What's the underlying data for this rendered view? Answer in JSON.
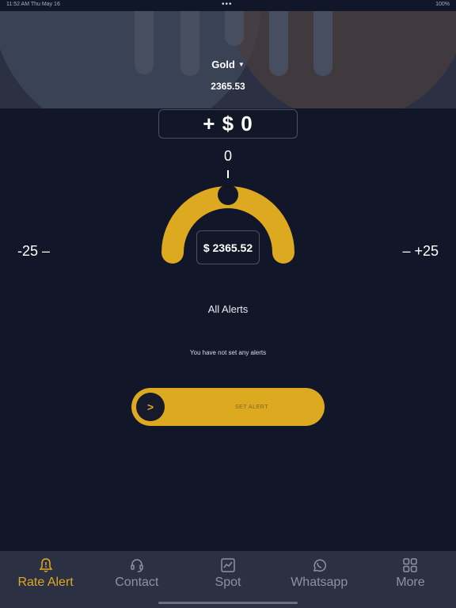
{
  "status_bar": {
    "left": "11:52 AM  Thu May 16",
    "center": "•••",
    "right": "100%"
  },
  "header": {
    "metal": "Gold",
    "price": "2365.53"
  },
  "calculator": {
    "delta_display": "+ $ 0",
    "offset_value": "0",
    "current_rate": "$ 2365.52",
    "minus_step": "-25 –",
    "plus_step": "– +25"
  },
  "alerts": {
    "title": "All Alerts",
    "empty_message": "You have not set any alerts"
  },
  "slider": {
    "label": "SET ALERT",
    "knob_symbol": ">"
  },
  "tabs": [
    {
      "label": "Rate Alert",
      "icon": "bell-icon",
      "active": true
    },
    {
      "label": "Contact",
      "icon": "headset-icon",
      "active": false
    },
    {
      "label": "Spot",
      "icon": "chart-icon",
      "active": false
    },
    {
      "label": "Whatsapp",
      "icon": "whatsapp-icon",
      "active": false
    },
    {
      "label": "More",
      "icon": "grid-icon",
      "active": false
    }
  ],
  "colors": {
    "background": "#111628",
    "panel": "#2b3142",
    "accent": "#dca920",
    "inactive": "#8c92a4"
  }
}
